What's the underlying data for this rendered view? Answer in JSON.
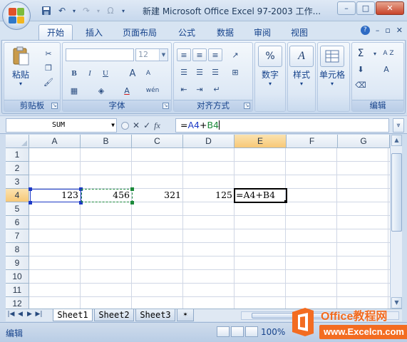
{
  "window": {
    "title": "新建 Microsoft Office Excel 97-2003 工作...",
    "controls": [
      "–",
      "□",
      "✕"
    ]
  },
  "qat": {
    "save": "💾",
    "undo": "↶",
    "redo": "↷",
    "omega": "Ω",
    "more": "▾"
  },
  "tabs": [
    {
      "label": "开始",
      "active": true
    },
    {
      "label": "插入"
    },
    {
      "label": "页面布局"
    },
    {
      "label": "公式"
    },
    {
      "label": "数据"
    },
    {
      "label": "审阅"
    },
    {
      "label": "视图"
    }
  ],
  "ribbon": {
    "clipboard": {
      "label": "剪贴板",
      "paste": "粘贴"
    },
    "font": {
      "label": "字体",
      "font_name": "",
      "font_size": "12",
      "bold": "B",
      "italic": "I",
      "underline": "U",
      "grow": "A",
      "shrink": "A",
      "font_color": "A",
      "phonetic": "wén"
    },
    "alignment": {
      "label": "对齐方式"
    },
    "number": {
      "label": "数字",
      "icon": "%"
    },
    "styles": {
      "label": "样式",
      "icon": "A"
    },
    "cells": {
      "label": "单元格"
    },
    "editing": {
      "label": "编辑",
      "sum": "Σ",
      "sort": "A Z",
      "find": "A"
    }
  },
  "formula_bar": {
    "name_box": "SUM",
    "fx": "fx",
    "cancel": "✕",
    "enter": "✓",
    "formula": "=A4+B4"
  },
  "sheet": {
    "columns": [
      "A",
      "B",
      "C",
      "D",
      "E",
      "F",
      "G"
    ],
    "rows": [
      "1",
      "2",
      "3",
      "4",
      "5",
      "6",
      "7",
      "8",
      "9",
      "10",
      "11",
      "12"
    ],
    "row4": {
      "A": "123",
      "B": "456",
      "C": "321",
      "D": "125",
      "E": "=A4+B4"
    },
    "active_cell": "E4"
  },
  "sheet_tabs": [
    "Sheet1",
    "Sheet2",
    "Sheet3"
  ],
  "status": {
    "mode": "编辑",
    "zoom": "100%"
  },
  "watermark": {
    "line1": "Office教程网",
    "line2": "www.Excelcn.com"
  },
  "colors": {
    "accent": "#15428b",
    "ref_a": "#1c39c6",
    "ref_b": "#1c8a3a",
    "sel_header": "#f7c877",
    "watermark": "#f36c21"
  }
}
